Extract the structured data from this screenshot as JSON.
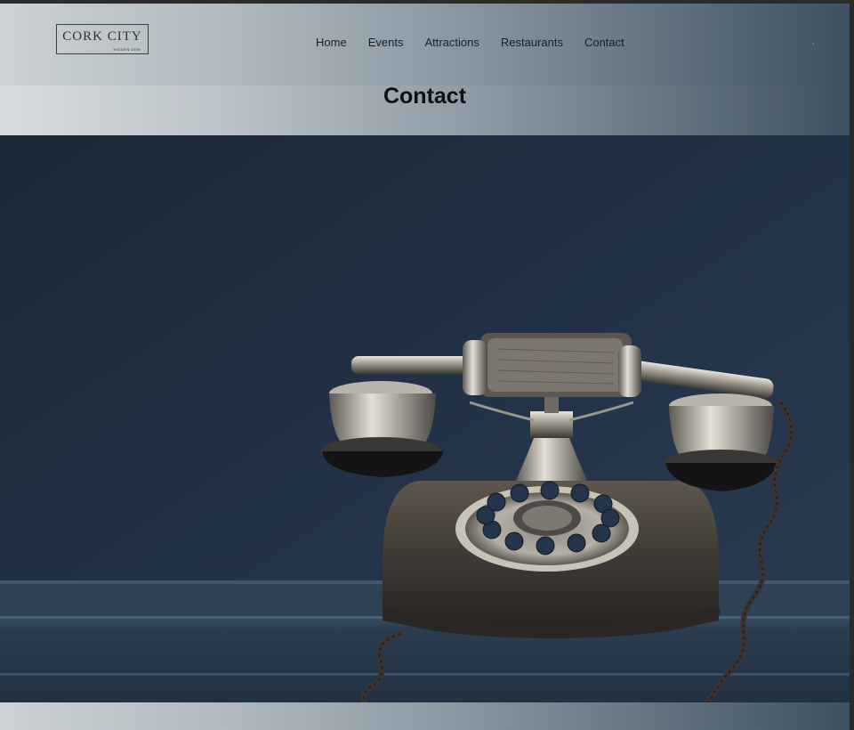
{
  "brand": {
    "name": "CORK CITY",
    "tagline": "HIDDEN GEM"
  },
  "nav": {
    "items": [
      {
        "label": "Home"
      },
      {
        "label": "Events"
      },
      {
        "label": "Attractions"
      },
      {
        "label": "Restaurants"
      },
      {
        "label": "Contact"
      }
    ]
  },
  "page": {
    "title": "Contact"
  },
  "hero": {
    "image": "vintage-rotary-telephone-photo"
  },
  "colors": {
    "header_gradient_start": "#ccd2d6",
    "header_gradient_end": "#3f5060",
    "hero_background": "#243343",
    "title_text": "#0d0f12"
  }
}
